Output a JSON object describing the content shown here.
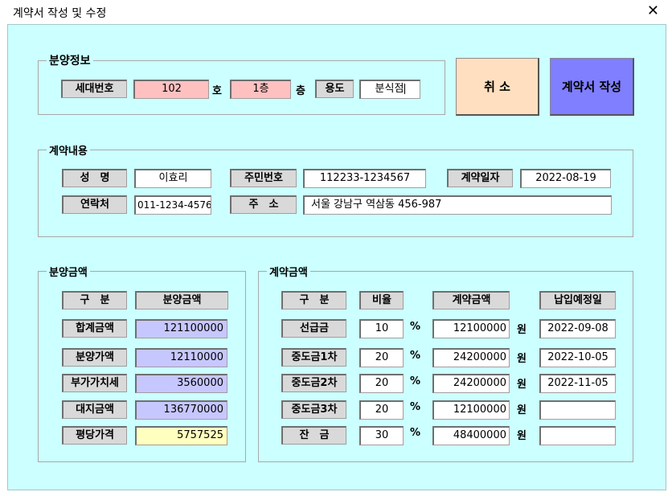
{
  "window": {
    "title": "계약서 작성 및 수정",
    "close_glyph": "✕"
  },
  "sale_info": {
    "legend": "분양정보",
    "unit_label": "세대번호",
    "unit_no": "102",
    "ho_suffix": "호",
    "floor": "1층",
    "floor_suffix": "층",
    "usage_label": "용도",
    "usage": "분식점"
  },
  "buttons": {
    "cancel": "취 소",
    "create": "계약서 작성"
  },
  "contract": {
    "legend": "계약내용",
    "name_label": "성　명",
    "name": "이효리",
    "id_label": "주민번호",
    "id_no": "112233-1234567",
    "date_label": "계약일자",
    "date": "2022-08-19",
    "phone_label": "연락처",
    "phone": "011-1234-4576",
    "addr_label": "주　소",
    "address": "서울 강남구 역삼동 456-987"
  },
  "sale_amount": {
    "legend": "분양금액",
    "col1": "구　분",
    "col2": "분양금액",
    "rows": [
      {
        "label": "합계금액",
        "value": "121100000"
      },
      {
        "label": "분양가액",
        "value": "12110000"
      },
      {
        "label": "부가가치세",
        "value": "3560000"
      },
      {
        "label": "대지금액",
        "value": "136770000"
      },
      {
        "label": "평당가격",
        "value": "5757525"
      }
    ]
  },
  "contract_amount": {
    "legend": "계약금액",
    "col1": "구　분",
    "col2": "비율",
    "col3": "계약금액",
    "col4": "납입예정일",
    "pct": "%",
    "won": "원",
    "rows": [
      {
        "label": "선급금",
        "ratio": "10",
        "amount": "12100000",
        "due": "2022-09-08"
      },
      {
        "label": "중도금1차",
        "ratio": "20",
        "amount": "24200000",
        "due": "2022-10-05"
      },
      {
        "label": "중도금2차",
        "ratio": "20",
        "amount": "24200000",
        "due": "2022-11-05"
      },
      {
        "label": "중도금3차",
        "ratio": "20",
        "amount": "12100000",
        "due": ""
      },
      {
        "label": "잔　금",
        "ratio": "30",
        "amount": "48400000",
        "due": ""
      }
    ]
  },
  "colors": {
    "background": "#ccffff",
    "cancel_btn": "#ffdfc0",
    "create_btn": "#7f7fff"
  }
}
